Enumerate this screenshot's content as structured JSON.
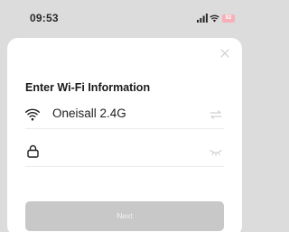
{
  "status_bar": {
    "time": "09:53",
    "battery": "92",
    "icons": [
      "cellular-signal-icon",
      "wifi-icon",
      "battery-icon"
    ]
  },
  "sheet": {
    "title": "Enter Wi-Fi Information",
    "close_icon": "close-icon",
    "ssid": {
      "icon": "wifi-icon",
      "value": "Oneisall 2.4G",
      "action_icon": "switch-network-icon"
    },
    "password": {
      "icon": "lock-icon",
      "value": "",
      "placeholder": "",
      "action_icon": "eye-closed-icon"
    },
    "next_button": "Next"
  },
  "colors": {
    "background": "#dcdcdc",
    "sheet": "#ffffff",
    "button_disabled": "#c8c8c8",
    "battery": "#f6b0b7"
  }
}
